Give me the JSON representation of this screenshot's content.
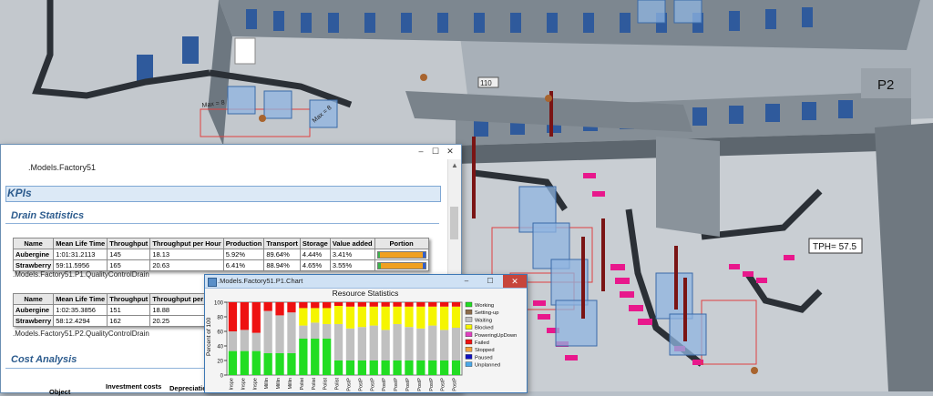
{
  "scene": {
    "zone_label": "P2",
    "tph_label": "TPH= 57.5",
    "counter_label": "110",
    "max_labels": [
      "Max = 8",
      "Max = 8"
    ]
  },
  "kpi_window": {
    "title": ".Models.Factory51",
    "kpis_heading": "KPIs",
    "drain_heading": "Drain Statistics",
    "cost_heading": "Cost Analysis",
    "table_headers": [
      "Name",
      "Mean Life Time",
      "Throughput",
      "Throughput per Hour",
      "Production",
      "Transport",
      "Storage",
      "Value added",
      "Portion"
    ],
    "table1": {
      "rows": [
        {
          "name": "Aubergine",
          "mean_life_time": "1:01:31.2113",
          "throughput": "145",
          "tph": "18.13",
          "production": "5.92%",
          "transport": "89.64%",
          "storage": "4.44%",
          "value_added": "3.41%",
          "portion": [
            0.05,
            0.9,
            0.05
          ]
        },
        {
          "name": "Strawberry",
          "mean_life_time": "59:11.5956",
          "throughput": "165",
          "tph": "20.63",
          "production": "6.41%",
          "transport": "88.94%",
          "storage": "4.65%",
          "value_added": "3.55%",
          "portion": [
            0.06,
            0.89,
            0.05
          ]
        }
      ],
      "caption": ".Models.Factory51.P1.QualityControlDrain"
    },
    "table2": {
      "rows": [
        {
          "name": "Aubergine",
          "mean_life_time": "1:02:35.3856",
          "throughput": "151",
          "tph": "18.88"
        },
        {
          "name": "Strawberry",
          "mean_life_time": "58:12.4294",
          "throughput": "162",
          "tph": "20.25"
        }
      ],
      "caption": ".Models.Factory51.P2.QualityControlDrain"
    },
    "cost_headers": [
      "Object",
      "Investment costs",
      "Depreciation p"
    ],
    "portion_colors": [
      "#3cb44b",
      "#f0a020",
      "#3060d0"
    ]
  },
  "chart_window": {
    "title": ".Models.Factory51.P1.Chart",
    "chart_data": {
      "type": "bar",
      "stacked": true,
      "title": "Resource Statistics",
      "ylabel": "Percent of 100",
      "ylim": [
        0,
        100
      ],
      "y_ticks": [
        0,
        20,
        40,
        60,
        80,
        100
      ],
      "categories": [
        "Inspe",
        "Inspe",
        "Inspe",
        "Millin",
        "Millin",
        "Millin",
        "Polist",
        "Polist",
        "Polist",
        "Polist",
        "PostP",
        "PostP",
        "PostP",
        "PostP",
        "PostP",
        "PostP",
        "PostP",
        "PostP",
        "PostP",
        "PostP"
      ],
      "series": [
        {
          "name": "Working",
          "color": "#22dd22",
          "values": [
            33,
            33,
            33,
            30,
            30,
            30,
            50,
            50,
            50,
            20,
            20,
            20,
            20,
            20,
            20,
            20,
            20,
            20,
            20,
            20
          ]
        },
        {
          "name": "Setting-up",
          "color": "#8b6b4a",
          "values": [
            0,
            0,
            0,
            0,
            0,
            0,
            0,
            0,
            0,
            0,
            0,
            0,
            0,
            0,
            0,
            0,
            0,
            0,
            0,
            0
          ]
        },
        {
          "name": "Waiting",
          "color": "#c0c0c0",
          "values": [
            27,
            29,
            25,
            58,
            52,
            56,
            18,
            22,
            20,
            50,
            44,
            46,
            48,
            42,
            50,
            46,
            44,
            48,
            42,
            45
          ]
        },
        {
          "name": "Blocked",
          "color": "#f5f500",
          "values": [
            0,
            0,
            0,
            0,
            0,
            0,
            24,
            20,
            22,
            25,
            30,
            28,
            26,
            32,
            24,
            28,
            30,
            26,
            32,
            29
          ]
        },
        {
          "name": "PoweringUpDown",
          "color": "#e040c0",
          "values": [
            0,
            0,
            0,
            0,
            0,
            0,
            0,
            0,
            0,
            0,
            0,
            0,
            0,
            0,
            0,
            0,
            0,
            0,
            0,
            0
          ]
        },
        {
          "name": "Failed",
          "color": "#ee1111",
          "values": [
            40,
            38,
            42,
            12,
            18,
            14,
            8,
            8,
            8,
            5,
            6,
            6,
            6,
            6,
            6,
            6,
            6,
            6,
            6,
            6
          ]
        },
        {
          "name": "Stopped",
          "color": "#f0a040",
          "values": [
            0,
            0,
            0,
            0,
            0,
            0,
            0,
            0,
            0,
            0,
            0,
            0,
            0,
            0,
            0,
            0,
            0,
            0,
            0,
            0
          ]
        },
        {
          "name": "Paused",
          "color": "#1010c0",
          "values": [
            0,
            0,
            0,
            0,
            0,
            0,
            0,
            0,
            0,
            0,
            0,
            0,
            0,
            0,
            0,
            0,
            0,
            0,
            0,
            0
          ]
        },
        {
          "name": "Unplanned",
          "color": "#4aa8e8",
          "values": [
            0,
            0,
            0,
            0,
            0,
            0,
            0,
            0,
            0,
            0,
            0,
            0,
            0,
            0,
            0,
            0,
            0,
            0,
            0,
            0
          ]
        }
      ],
      "legend": "right",
      "grid": false
    }
  }
}
